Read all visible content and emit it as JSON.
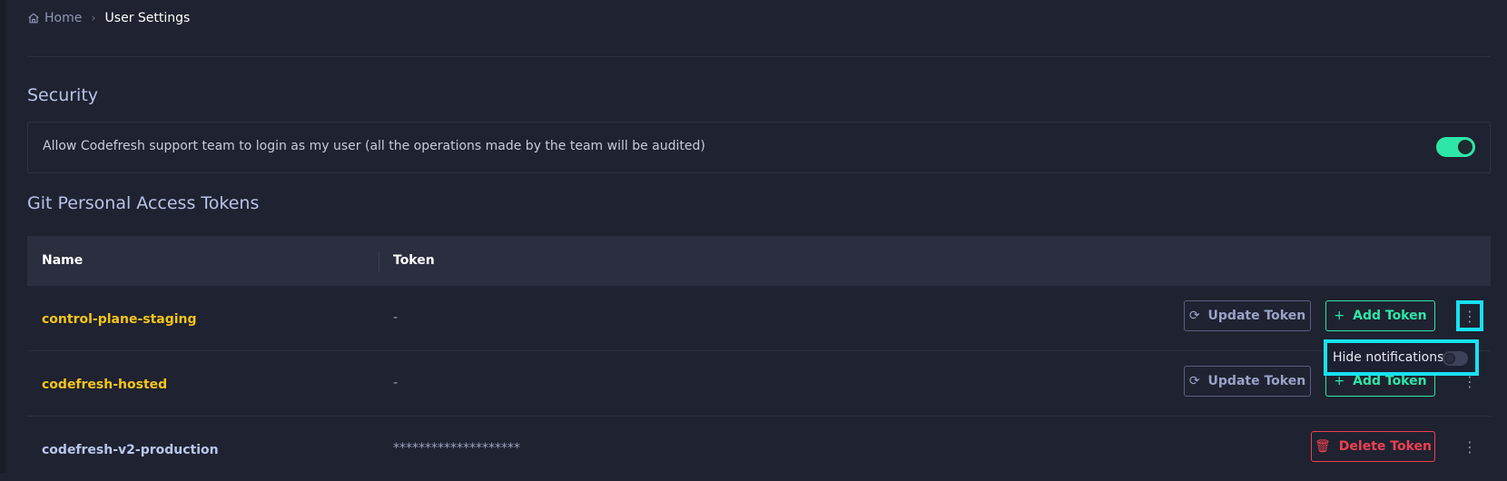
{
  "breadcrumb": {
    "home": "Home",
    "current": "User Settings"
  },
  "security": {
    "title": "Security",
    "text": "Allow Codefresh support team to login as my user (all the operations made by the team will be audited)",
    "enabled": true
  },
  "tokens": {
    "title": "Git Personal Access Tokens",
    "columns": {
      "name": "Name",
      "token": "Token"
    },
    "rows": [
      {
        "name": "control-plane-staging",
        "token": "-",
        "update_label": "Update Token",
        "add_label": "Add Token",
        "name_color": "#f5c518"
      },
      {
        "name": "codefresh-hosted",
        "token": "-",
        "update_label": "Update Token",
        "add_label": "Add Token",
        "name_color": "#f5c518"
      },
      {
        "name": "codefresh-v2-production",
        "token": "********************",
        "delete_label": "Delete Token",
        "name_color": "#b9c6ec"
      }
    ]
  },
  "popup": {
    "label": "Hide notifications",
    "enabled": false
  },
  "colors": {
    "accent": "#2ee6a8",
    "danger": "#ef4052",
    "highlight": "#18e1f2"
  },
  "icons": [
    "home-icon",
    "chevron-right-icon",
    "refresh-icon",
    "plus-icon",
    "trash-icon",
    "more-vertical-icon"
  ]
}
